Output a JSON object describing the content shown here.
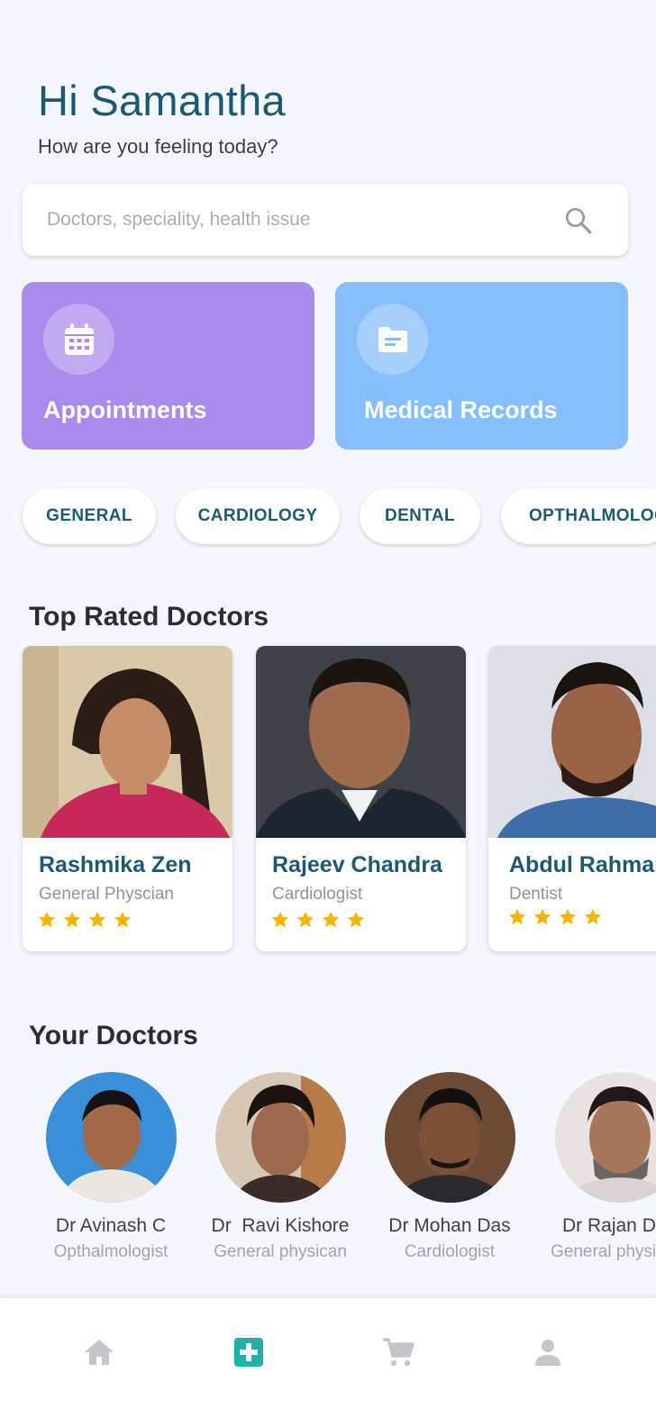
{
  "header": {
    "greeting": "Hi Samantha",
    "subtitle": "How are you feeling today?"
  },
  "search": {
    "placeholder": "Doctors, speciality, health issue",
    "icon": "search-icon"
  },
  "quick_actions": [
    {
      "label": "Appointments",
      "icon": "calendar-icon",
      "color": "#ab8aee"
    },
    {
      "label": "Medical Records",
      "icon": "folder-icon",
      "color": "#86bdfb"
    }
  ],
  "categories": [
    "GENERAL",
    "CARDIOLOGY",
    "DENTAL",
    "OPTHALMOLOGY"
  ],
  "top_rated": {
    "title": "Top Rated Doctors",
    "doctors": [
      {
        "name": "Rashmika Zen",
        "speciality": "General Physcian",
        "rating": 4
      },
      {
        "name": "Rajeev Chandra",
        "speciality": "Cardiologist",
        "rating": 4
      },
      {
        "name": "Abdul Rahman",
        "speciality": "Dentist",
        "rating": 4
      }
    ]
  },
  "your_doctors": {
    "title": "Your Doctors",
    "doctors": [
      {
        "name": "Dr Avinash C",
        "speciality": "Opthalmologist"
      },
      {
        "name": "Dr  Ravi Kishore",
        "speciality": "General physican"
      },
      {
        "name": "Dr Mohan Das",
        "speciality": "Cardiologist"
      },
      {
        "name": "Dr Rajan D",
        "speciality": "General physican"
      }
    ]
  },
  "bottom_nav": [
    {
      "icon": "home-icon",
      "active": false
    },
    {
      "icon": "medical-cross-icon",
      "active": true
    },
    {
      "icon": "cart-icon",
      "active": false
    },
    {
      "icon": "profile-icon",
      "active": false
    }
  ],
  "colors": {
    "primary": "#1c5a73",
    "accent": "#1fb0a7",
    "star": "#f4b400",
    "background": "#f4f7fd"
  }
}
